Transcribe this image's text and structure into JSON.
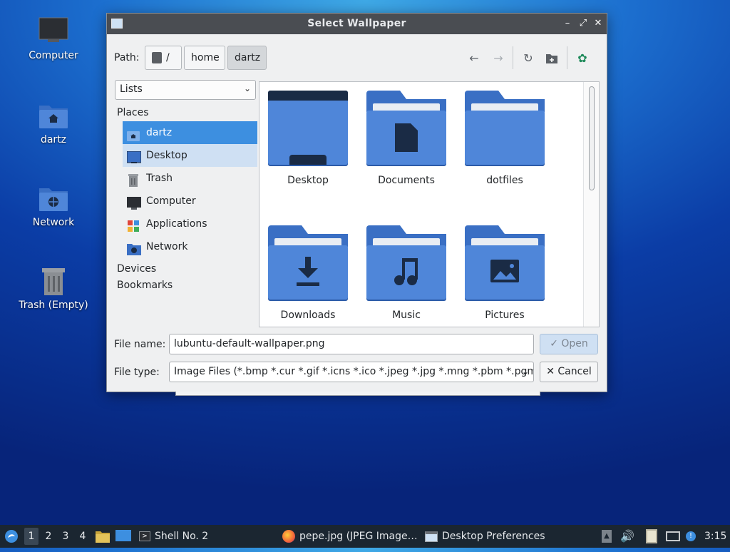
{
  "desktop": {
    "icons": [
      {
        "label": "Computer"
      },
      {
        "label": "dartz"
      },
      {
        "label": "Network"
      },
      {
        "label": "Trash (Empty)"
      }
    ]
  },
  "dialog": {
    "title": "Select Wallpaper",
    "path_label": "Path:",
    "breadcrumbs": [
      "/",
      "home",
      "dartz"
    ],
    "view_mode": "Lists",
    "sidebar": {
      "places_header": "Places",
      "items": [
        {
          "label": "dartz",
          "icon": "home-folder-icon",
          "state": "selected"
        },
        {
          "label": "Desktop",
          "icon": "desktop-icon",
          "state": "hover"
        },
        {
          "label": "Trash",
          "icon": "trash-icon"
        },
        {
          "label": "Computer",
          "icon": "computer-icon"
        },
        {
          "label": "Applications",
          "icon": "applications-icon"
        },
        {
          "label": "Network",
          "icon": "network-icon"
        }
      ],
      "devices_header": "Devices",
      "bookmarks_header": "Bookmarks"
    },
    "files": [
      {
        "name": "Desktop",
        "icon": "desktop-folder-icon"
      },
      {
        "name": "Documents",
        "icon": "documents-folder-icon"
      },
      {
        "name": "dotfiles",
        "icon": "folder-icon"
      },
      {
        "name": "Downloads",
        "icon": "downloads-folder-icon"
      },
      {
        "name": "Music",
        "icon": "music-folder-icon"
      },
      {
        "name": "Pictures",
        "icon": "pictures-folder-icon"
      }
    ],
    "file_name_label": "File name:",
    "file_name_value": "lubuntu-default-wallpaper.png",
    "file_type_label": "File type:",
    "file_type_value": "Image Files (*.bmp *.cur *.gif *.icns *.ico *.jpeg *.jpg *.mng *.pbm *.pgm",
    "open_label": "Open",
    "cancel_label": "Cancel"
  },
  "taskbar": {
    "workspaces": [
      "1",
      "2",
      "3",
      "4"
    ],
    "tasks": [
      {
        "label": "Shell No. 2",
        "icon": "terminal-icon"
      },
      {
        "label": "pepe.jpg (JPEG Image…",
        "icon": "firefox-icon"
      },
      {
        "label": "Desktop Preferences",
        "icon": "window-icon"
      }
    ],
    "clock": "3:15"
  },
  "colors": {
    "accent": "#3d8fe0",
    "folder": "#4f86d9",
    "titlebar": "#4a4d52",
    "taskbar": "#1b2631"
  }
}
